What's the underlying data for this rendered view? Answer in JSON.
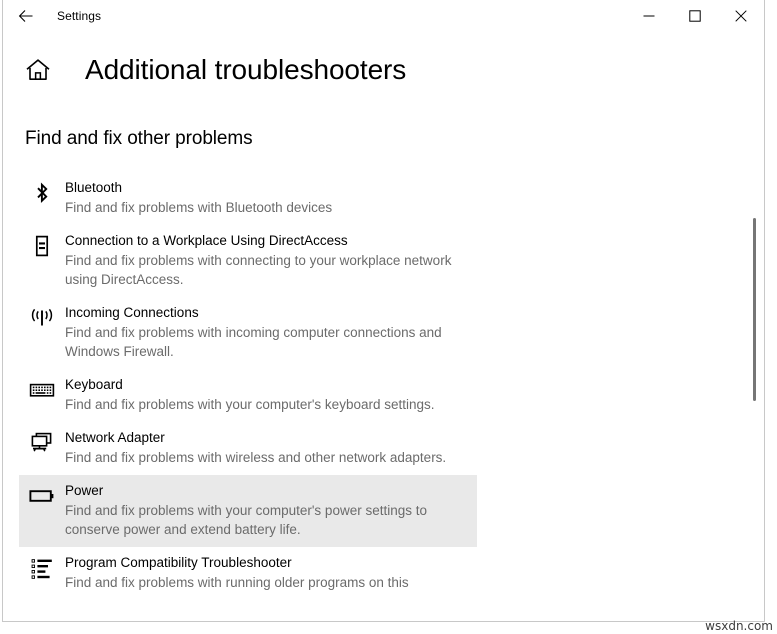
{
  "window": {
    "title": "Settings",
    "back_icon": "back-arrow-icon",
    "controls": {
      "minimize": "minimize-icon",
      "maximize": "maximize-icon",
      "close": "close-icon"
    }
  },
  "header": {
    "home_icon": "home-icon",
    "page_title": "Additional troubleshooters"
  },
  "section": {
    "heading": "Find and fix other problems"
  },
  "troubleshooters": [
    {
      "icon": "bluetooth-icon",
      "title": "Bluetooth",
      "description": "Find and fix problems with Bluetooth devices",
      "selected": false
    },
    {
      "icon": "workplace-device-icon",
      "title": "Connection to a Workplace Using DirectAccess",
      "description": "Find and fix problems with connecting to your workplace network using DirectAccess.",
      "selected": false
    },
    {
      "icon": "broadcast-antenna-icon",
      "title": "Incoming Connections",
      "description": "Find and fix problems with incoming computer connections and Windows Firewall.",
      "selected": false
    },
    {
      "icon": "keyboard-icon",
      "title": "Keyboard",
      "description": "Find and fix problems with your computer's keyboard settings.",
      "selected": false
    },
    {
      "icon": "network-adapter-icon",
      "title": "Network Adapter",
      "description": "Find and fix problems with wireless and other network adapters.",
      "selected": false
    },
    {
      "icon": "battery-icon",
      "title": "Power",
      "description": "Find and fix problems with your computer's power settings to conserve power and extend battery life.",
      "selected": true
    },
    {
      "icon": "list-icon",
      "title": "Program Compatibility Troubleshooter",
      "description": "Find and fix problems with running older programs on this",
      "selected": false
    }
  ],
  "colors": {
    "selection": "#e9e9e9",
    "text": "#000000",
    "subtext": "#6b6b6b",
    "scrollbar": "#767676",
    "window_border": "#c8c8c8"
  },
  "watermark": "wsxdn.com"
}
